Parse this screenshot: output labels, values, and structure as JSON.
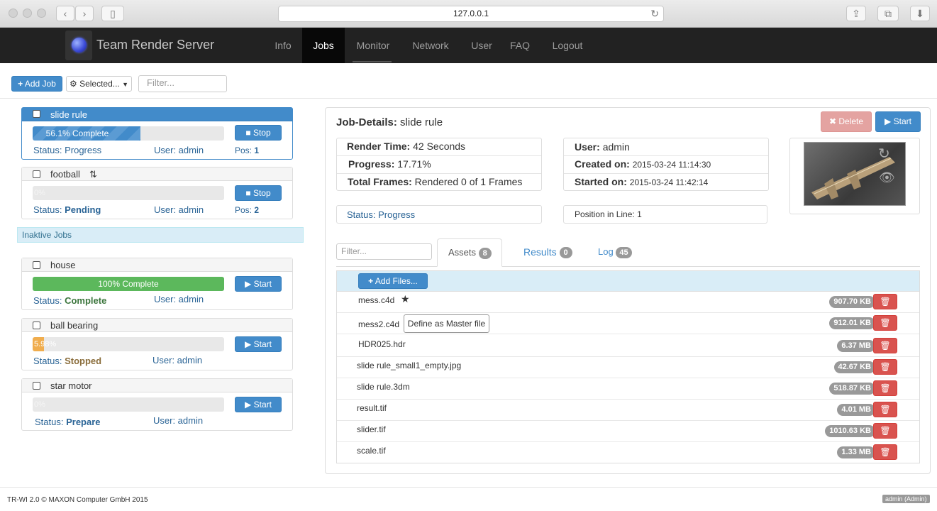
{
  "browser": {
    "url": "127.0.0.1"
  },
  "app": {
    "title": "Team Render Server"
  },
  "nav": {
    "info": "Info",
    "jobs": "Jobs",
    "monitor": "Monitor",
    "network": "Network",
    "user": "User",
    "faq": "FAQ",
    "logout": "Logout"
  },
  "toolbar": {
    "add_job": "Add Job",
    "selected": "Selected...",
    "filter_placeholder": "Filter..."
  },
  "jobs": [
    {
      "name": "slide rule",
      "progress_label": "56.1% Complete",
      "progress": 56.1,
      "status_label": "Status:",
      "status": "Progress",
      "user": "User: admin",
      "pos_label": "Pos:",
      "pos": "1",
      "action": "Stop"
    },
    {
      "name": "football",
      "progress_label": "0%",
      "progress": 0,
      "status_label": "Status:",
      "status": "Pending",
      "user": "User: admin",
      "pos_label": "Pos:",
      "pos": "2",
      "action": "Stop"
    }
  ],
  "inactive_label": "Inaktive Jobs",
  "inactive_jobs": [
    {
      "name": "house",
      "progress_label": "100% Complete",
      "progress": 100,
      "status_label": "Status:",
      "status": "Complete",
      "user": "User: admin",
      "action": "Start"
    },
    {
      "name": "ball bearing",
      "progress_label": "5.98%",
      "progress": 5.98,
      "status_label": "Status:",
      "status": "Stopped",
      "user": "User: admin",
      "action": "Start"
    },
    {
      "name": "star motor",
      "progress_label": "0%",
      "progress": 0,
      "status_label": "Status:",
      "status": "Prepare",
      "user": "User: admin",
      "action": "Start"
    }
  ],
  "details": {
    "heading_label": "Job-Details:",
    "heading_name": "slide rule",
    "delete": "Delete",
    "start": "Start",
    "render_time_label": "Render Time:",
    "render_time": "42 Seconds",
    "progress_label": "Progress:",
    "progress": "17.71%",
    "total_frames_label": "Total Frames:",
    "total_frames": "Rendered 0 of 1 Frames",
    "user_label": "User:",
    "user": "admin",
    "created_label": "Created on:",
    "created": "2015-03-24 11:14:30",
    "started_label": "Started on:",
    "started": "2015-03-24 11:42:14",
    "status_label": "Status:",
    "status": "Progress",
    "position_label": "Position in Line:",
    "position": "1"
  },
  "tabs": {
    "filter_placeholder": "Filter...",
    "assets": {
      "label": "Assets",
      "count": "8"
    },
    "results": {
      "label": "Results",
      "count": "0"
    },
    "log": {
      "label": "Log",
      "count": "45"
    }
  },
  "assets": {
    "add_files": "Add Files...",
    "define_master": "Define as Master file",
    "items": [
      {
        "name": "mess.c4d",
        "size": "907.70 KB"
      },
      {
        "name": "mess2.c4d",
        "size": "912.01 KB"
      },
      {
        "name": "HDR025.hdr",
        "size": "6.37 MB"
      },
      {
        "name": "slide rule_small1_empty.jpg",
        "size": "42.67 KB"
      },
      {
        "name": "slide rule.3dm",
        "size": "518.87 KB"
      },
      {
        "name": "result.tif",
        "size": "4.01 MB"
      },
      {
        "name": "slider.tif",
        "size": "1010.63 KB"
      },
      {
        "name": "scale.tif",
        "size": "1.33 MB"
      }
    ]
  },
  "footer": {
    "copyright": "TR-WI 2.0 © MAXON Computer GmbH 2015",
    "user_badge": "admin (Admin)"
  },
  "colors": {
    "primary": "#428bca",
    "success": "#5cb85c",
    "warning": "#f0ad4e",
    "danger": "#d9534f",
    "navbar": "#222222"
  }
}
